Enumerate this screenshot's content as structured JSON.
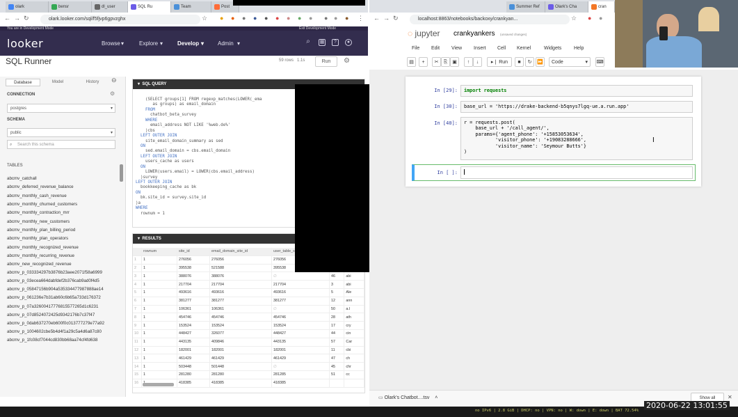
{
  "left_browser": {
    "tabs": [
      "olark",
      "bensr",
      "dl_user",
      "SQL Ru",
      "Team",
      "Post"
    ],
    "url": "olark.looker.com/sql/f5fjvp6gpvzghx",
    "dev_mode_left": "You are in Development Mode",
    "dev_mode_right": "Exit Development Mode",
    "logo": "looker",
    "nav": [
      "Browse",
      "Explore",
      "Develop",
      "Admin"
    ],
    "page_title": "SQL Runner",
    "rows_info": "59 rows",
    "time_info": "1.1s",
    "run_label": "Run",
    "sidebar": {
      "tabs": [
        "Database",
        "Model",
        "History"
      ],
      "connection_label": "CONNECTION",
      "connection_value": "postgres",
      "schema_label": "SCHEMA",
      "schema_value": "public",
      "search_placeholder": "Search this schema",
      "tables_label": "TABLES",
      "tables": [
        "abcmv_catchall",
        "abcmv_deferred_revenue_balance",
        "abcmv_monthly_cash_revenue",
        "abcmv_monthly_churned_customers",
        "abcmv_monthly_contraction_mrr",
        "abcmv_monthly_new_customers",
        "abcmv_monthly_plan_billing_period",
        "abcmv_monthly_plan_operators",
        "abcmv_monthly_recognized_revenue",
        "abcmv_monthly_recurring_revenue",
        "abcmv_new_recognized_revenue",
        "abcmv_p_033334297b3876b23aee2071f58a6999",
        "abcmv_p_03ecea664dabfdef2b376cab9ad0f4d5",
        "abcmv_p_05847156b904a535334477987888ae14",
        "abcmv_p_061236e7b31ab60c6b65a733d176372",
        "abcmv_p_07a32600417776815577265d1c6231",
        "abcmv_p_07d8524072425d9342176b7c37f47",
        "abcmv_p_0dab637270eb600f0c013777279e77a92",
        "abcmv_p_1004602cbe5b4d4f1a29c5a4d6a87c80",
        "abcmv_p_1fc08cf7044cd830bb68aa74cf4fd638"
      ]
    },
    "query_header": "SQL QUERY",
    "query_lines": [
      "    (SELECT groups[1] FROM regexp_matches(LOWER(_ema",
      "       as groups) as email_domain",
      "    FROM",
      "      chatbot_beta_survey",
      "    WHERE",
      "      email_address NOT LIKE '%web.de%'",
      "    )cbs",
      "  LEFT OUTER JOIN",
      "    site_email_domain_summary as sed",
      "  ON",
      "    sed.email_domain = cbs.email_domain",
      "  LEFT OUTER JOIN",
      "    users_cache as users",
      "  ON",
      "    LOWER(users.email) = LOWER(cbs.email_address)",
      "  )survey",
      "LEFT OUTER JOIN",
      "  bookkeeping_cache as bk",
      "ON",
      "  bk.site_id = survey.site_id",
      ")a",
      "WHERE",
      "  rownum = 1"
    ],
    "results_header": "RESULTS",
    "result_columns": [
      "rownum",
      "site_id",
      "email_domain_site_id",
      "user_table_s"
    ],
    "result_rows": [
      [
        "1",
        "1",
        "276056",
        "276056",
        "276056",
        "",
        ""
      ],
      [
        "2",
        "1",
        "395538",
        "521588",
        "395538",
        "",
        ""
      ],
      [
        "3",
        "1",
        "388076",
        "388076",
        "∅",
        "46",
        "abi"
      ],
      [
        "4",
        "1",
        "217704",
        "217704",
        "217704",
        "3",
        "abi"
      ],
      [
        "5",
        "1",
        "493616",
        "493616",
        "493616",
        "5",
        "Ale"
      ],
      [
        "6",
        "1",
        "381277",
        "381277",
        "381277",
        "12",
        "ann"
      ],
      [
        "7",
        "1",
        "106361",
        "106361",
        "∅",
        "50",
        "a.l"
      ],
      [
        "8",
        "1",
        "454746",
        "454746",
        "454746",
        "28",
        "ath"
      ],
      [
        "9",
        "1",
        "153524",
        "153524",
        "153524",
        "17",
        "cry"
      ],
      [
        "10",
        "1",
        "448427",
        "326077",
        "448427",
        "44",
        "cin"
      ],
      [
        "11",
        "1",
        "443135",
        "409846",
        "443135",
        "57",
        "Car"
      ],
      [
        "12",
        "1",
        "182001",
        "182001",
        "182001",
        "11",
        "cbi"
      ],
      [
        "13",
        "1",
        "461429",
        "461429",
        "461429",
        "47",
        "ch"
      ],
      [
        "14",
        "1",
        "503448",
        "501448",
        "∅",
        "45",
        "chr"
      ],
      [
        "15",
        "1",
        "281280",
        "281280",
        "281285",
        "51",
        "cc"
      ],
      [
        "16",
        "1",
        "418385",
        "418385",
        "418385",
        "",
        ""
      ]
    ]
  },
  "right_browser": {
    "tabs": [
      "Summer Ref",
      "Olark's Cha",
      "cran"
    ],
    "url": "localhost:8863/notebooks/backoxy/crankyan...",
    "jupyter_logo": "jupyter",
    "notebook_name": "crankyankers",
    "saved_status": "(unsaved changes)",
    "menu": [
      "File",
      "Edit",
      "View",
      "Insert",
      "Cell",
      "Kernel",
      "Widgets",
      "Help"
    ],
    "run_button": "Run",
    "cell_type": "Code",
    "cells": [
      {
        "prompt": "In [29]:",
        "code": "import requests"
      },
      {
        "prompt": "In [30]:",
        "code": "base_url = 'https://drake-backend-b5qnys7lgq-ue.a.run.app'"
      },
      {
        "prompt": "In [40]:",
        "code": "r = requests.post(\n    base_url + '/call_agent/',\n    params={'agent_phone': '+15853053634',\n           'visitor_phone': '+19083288666',\n           'visitor_name': 'Seymour Butts'}\n)"
      },
      {
        "prompt": "In [ ]:",
        "code": ""
      }
    ],
    "download_item": "Olark's Chatbot....tsv",
    "show_all": "Show all"
  },
  "taskbar": {
    "clock": "2020-06-22 13:01:55",
    "status": "no IPv6 | 2.8 GiB | DHCP: no | VPN: no | W: down | E: down | BAT 72.54%"
  },
  "colors": {
    "looker_header": "#332d4e",
    "jupyter_orange": "#f37726",
    "prompt_blue": "#303f9f"
  }
}
